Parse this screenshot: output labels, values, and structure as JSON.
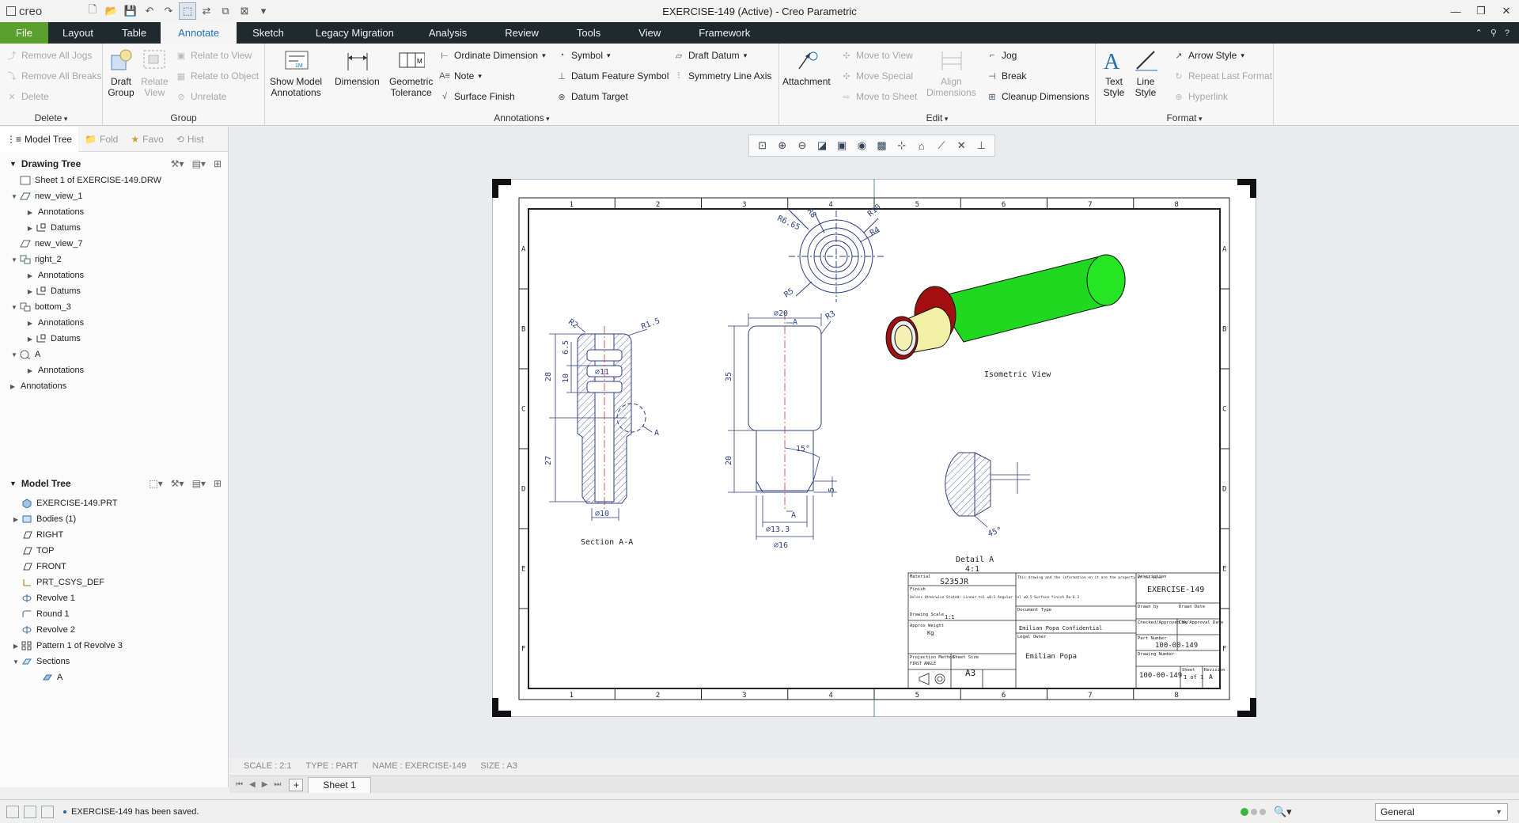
{
  "titlebar": {
    "app": "creo",
    "title": "EXERCISE-149 (Active) - Creo Parametric",
    "minimize": "—",
    "maximize": "❐",
    "close": "✕"
  },
  "tabs": [
    "File",
    "Layout",
    "Table",
    "Annotate",
    "Sketch",
    "Legacy Migration",
    "Analysis",
    "Review",
    "Tools",
    "View",
    "Framework"
  ],
  "active_tab": "Annotate",
  "ribbon": {
    "delete": {
      "label": "Delete",
      "items": [
        "Remove All Jogs",
        "Remove All Breaks",
        "Delete"
      ]
    },
    "group": {
      "label": "Group",
      "draft_group": "Draft\nGroup",
      "relate_view": "Relate\nView",
      "relate_to_view": "Relate to View",
      "relate_to_object": "Relate to Object",
      "unrelate": "Unrelate"
    },
    "annotations": {
      "label": "Annotations",
      "show_model": "Show Model\nAnnotations",
      "dimension": "Dimension",
      "geom_tol": "Geometric\nTolerance",
      "ordinate": "Ordinate Dimension",
      "note": "Note",
      "surface_finish": "Surface Finish",
      "symbol": "Symbol",
      "datum_feature_symbol": "Datum Feature Symbol",
      "datum_target": "Datum Target",
      "draft_datum": "Draft Datum",
      "symmetry_line_axis": "Symmetry Line Axis"
    },
    "edit": {
      "label": "Edit",
      "attachment": "Attachment",
      "move_to_view": "Move to View",
      "move_special": "Move Special",
      "move_to_sheet": "Move to Sheet",
      "align": "Align\nDimensions",
      "jog": "Jog",
      "break": "Break",
      "cleanup": "Cleanup Dimensions"
    },
    "format": {
      "label": "Format",
      "text_style": "Text\nStyle",
      "line_style": "Line\nStyle",
      "arrow_style": "Arrow Style",
      "repeat_last": "Repeat Last Format",
      "hyperlink": "Hyperlink"
    }
  },
  "navtabs": [
    "Model Tree",
    "Fold",
    "Favo",
    "Hist"
  ],
  "drawing_tree": {
    "title": "Drawing Tree",
    "nodes": [
      {
        "label": "Sheet 1 of EXERCISE-149.DRW",
        "level": 0,
        "tw": "",
        "icon": "sheet"
      },
      {
        "label": "new_view_1",
        "level": 0,
        "tw": "▼",
        "icon": "view"
      },
      {
        "label": "Annotations",
        "level": 1,
        "tw": "▶",
        "icon": ""
      },
      {
        "label": "Datums",
        "level": 1,
        "tw": "▶",
        "icon": "datum"
      },
      {
        "label": "new_view_7",
        "level": 0,
        "tw": "",
        "icon": "view"
      },
      {
        "label": "right_2",
        "level": 0,
        "tw": "▼",
        "icon": "proj"
      },
      {
        "label": "Annotations",
        "level": 1,
        "tw": "▶",
        "icon": ""
      },
      {
        "label": "Datums",
        "level": 1,
        "tw": "▶",
        "icon": "datum"
      },
      {
        "label": "bottom_3",
        "level": 0,
        "tw": "▼",
        "icon": "proj"
      },
      {
        "label": "Annotations",
        "level": 1,
        "tw": "▶",
        "icon": ""
      },
      {
        "label": "Datums",
        "level": 1,
        "tw": "▶",
        "icon": "datum"
      },
      {
        "label": "A",
        "level": 0,
        "tw": "▼",
        "icon": "detail"
      },
      {
        "label": "Annotations",
        "level": 1,
        "tw": "▶",
        "icon": ""
      },
      {
        "label": "Annotations",
        "level": -1,
        "tw": "▶",
        "icon": ""
      }
    ]
  },
  "model_tree": {
    "title": "Model Tree",
    "nodes": [
      {
        "label": "EXERCISE-149.PRT",
        "tw": "",
        "icon": "part"
      },
      {
        "label": "Bodies (1)",
        "tw": "▶",
        "icon": "body"
      },
      {
        "label": "RIGHT",
        "tw": "",
        "icon": "plane"
      },
      {
        "label": "TOP",
        "tw": "",
        "icon": "plane"
      },
      {
        "label": "FRONT",
        "tw": "",
        "icon": "plane"
      },
      {
        "label": "PRT_CSYS_DEF",
        "tw": "",
        "icon": "csys"
      },
      {
        "label": "Revolve 1",
        "tw": "",
        "icon": "rev"
      },
      {
        "label": "Round 1",
        "tw": "",
        "icon": "round"
      },
      {
        "label": "Revolve 2",
        "tw": "",
        "icon": "rev"
      },
      {
        "label": "Pattern 1 of Revolve 3",
        "tw": "▶",
        "icon": "pattern"
      },
      {
        "label": "Sections",
        "tw": "▼",
        "icon": "sect"
      },
      {
        "label": "A",
        "tw": "",
        "icon": "sectA"
      }
    ]
  },
  "drawing": {
    "zones_cols": [
      "1",
      "2",
      "3",
      "4",
      "5",
      "6",
      "7",
      "8"
    ],
    "zones_rows": [
      "A",
      "B",
      "C",
      "D",
      "E",
      "F"
    ],
    "dims": {
      "d20": "⌀20",
      "r3": "R3",
      "d35": "35",
      "d20v": "20",
      "d15": "15°",
      "d5": "5",
      "d133": "⌀13.3",
      "d16": "⌀16",
      "aTop": "A",
      "aBot": "A",
      "r2": "R2",
      "r15": "R1.5",
      "d65": "6.5",
      "d10": "10",
      "d11": "⌀11",
      "d28": "28",
      "d27": "27",
      "d10b": "⌀10",
      "aSec": "A",
      "r665": "R6.65",
      "r8": "R8",
      "r10": "R10",
      "r4": "R4",
      "r5": "R5",
      "a45": "45°"
    },
    "labels": {
      "section": "Section A-A",
      "iso": "Isometric View",
      "detail": "Detail A",
      "detail_scale": "4:1"
    },
    "titleblock": {
      "material_hdr": "Material",
      "material": "S235JR",
      "finish_hdr": "Finish",
      "desc_hdr": "Description",
      "desc": "EXERCISE-149",
      "note": "This drawing and the information on it are the property of the owner",
      "drawn_hdr": "Drawn by",
      "date_hdr": "Drawn Date",
      "checked_hdr": "Checked/Approved by",
      "chk_date_hdr": "Chk/Approval Date",
      "general_tol": "Unless Otherwise Stated: Linear tol ±0.1 Angular tol ±0.5 Surface finish Ra 6.3",
      "scale_hdr": "Drawing Scale",
      "scale": "1:1",
      "approx_weight_hdr": "Approx Weight",
      "approx_weight": "Kg",
      "doc_type_hdr": "Document Type",
      "company": "Emilian Popa Confidential",
      "legal_hdr": "Legal Owner",
      "owner": "Emilian Popa",
      "part_no_hdr": "Part Number",
      "part_no": "100-00-149",
      "proj_hdr": "Projection Method",
      "proj": "FIRST ANGLE",
      "size_hdr": "Sheet Size",
      "size": "A3",
      "drawing_no_hdr": "Drawing Number",
      "drawing_no": "100-00-149",
      "sheet_hdr": "Sheet",
      "sheet": "1 of 1",
      "rev_hdr": "Revision",
      "rev": "A"
    }
  },
  "status_info": [
    "SCALE : 2:1",
    "TYPE : PART",
    "NAME : EXERCISE-149",
    "SIZE : A3"
  ],
  "sheet_tab": "Sheet 1",
  "message": "EXERCISE-149 has been saved.",
  "filter": "General",
  "colors": {
    "accent": "#1f6fb5",
    "file_tab": "#5aa02c",
    "tabbar": "#1f2a2e",
    "dim_blue": "#2c3e86",
    "green": "#1fd81f",
    "yellow": "#f2f0a6",
    "red": "#a10f0f"
  }
}
